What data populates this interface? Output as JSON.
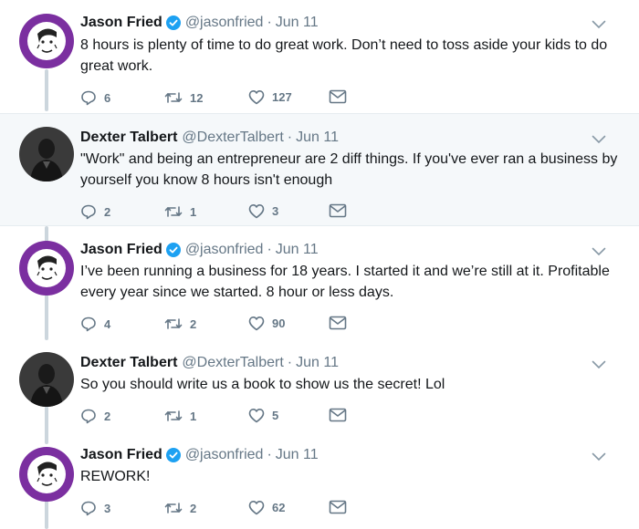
{
  "tweets": [
    {
      "name": "Jason Fried",
      "handle": "@jasonfried",
      "date": "Jun 11",
      "verified": true,
      "text": "8 hours is plenty of time to do great work. Don’t need to toss aside your kids to do great work.",
      "replies": "6",
      "retweets": "12",
      "likes": "127",
      "avatar_color": "#7b2fa0"
    },
    {
      "name": "Dexter Talbert",
      "handle": "@DexterTalbert",
      "date": "Jun 11",
      "verified": false,
      "text": "\"Work\" and being an entrepreneur are 2 diff things. If you've ever ran a business by yourself you know 8 hours isn't enough",
      "replies": "2",
      "retweets": "1",
      "likes": "3",
      "avatar_color": "#2a2a2a"
    },
    {
      "name": "Jason Fried",
      "handle": "@jasonfried",
      "date": "Jun 11",
      "verified": true,
      "text": "I’ve been running a business for 18 years. I started it and we’re still at it. Profitable every year since we started. 8 hour or less days.",
      "replies": "4",
      "retweets": "2",
      "likes": "90",
      "avatar_color": "#7b2fa0"
    },
    {
      "name": "Dexter Talbert",
      "handle": "@DexterTalbert",
      "date": "Jun 11",
      "verified": false,
      "text": "So you should write us a book to show us the secret! Lol",
      "replies": "2",
      "retweets": "1",
      "likes": "5",
      "avatar_color": "#2a2a2a"
    },
    {
      "name": "Jason Fried",
      "handle": "@jasonfried",
      "date": "Jun 11",
      "verified": true,
      "text": "REWORK!",
      "replies": "3",
      "retweets": "2",
      "likes": "62",
      "avatar_color": "#7b2fa0"
    }
  ],
  "separator": "·",
  "colors": {
    "text": "#14171a",
    "secondary": "#657786",
    "verified": "#1da1f2",
    "highlight_bg": "#f5f8fa",
    "thread_line": "#ccd6dd"
  },
  "icons": {
    "reply": "reply-icon",
    "retweet": "retweet-icon",
    "like": "heart-icon",
    "dm": "envelope-icon",
    "more": "chevron-down-icon",
    "verified": "verified-badge-icon"
  }
}
